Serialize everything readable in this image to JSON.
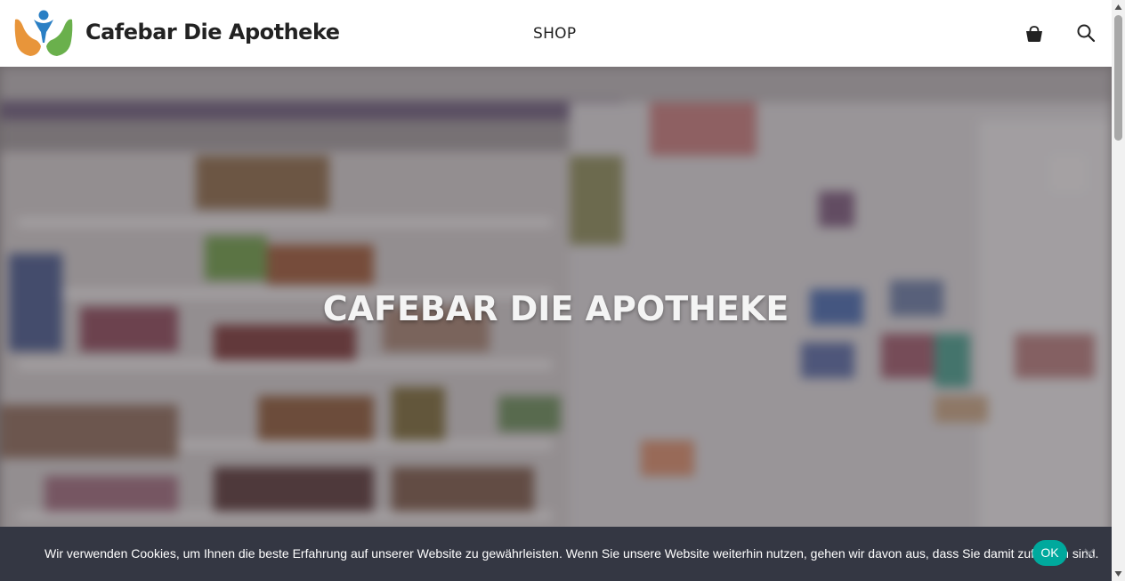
{
  "header": {
    "site_title": "Cafebar Die Apotheke",
    "nav": [
      {
        "label": "SHOP"
      }
    ],
    "icons": [
      "logo-icon",
      "cart-icon",
      "search-icon"
    ]
  },
  "hero": {
    "title": "CAFEBAR DIE APOTHEKE"
  },
  "cookie_notice": {
    "text": "Wir verwenden Cookies, um Ihnen die beste Erfahrung auf unserer Website zu gewährleisten. Wenn Sie unsere Website weiterhin nutzen, gehen wir davon aus, dass Sie damit zufrieden sind.",
    "ok_label": "OK",
    "close_icon": "close-icon"
  },
  "colors": {
    "accent": "#00a99d",
    "cookie_bar": "#343743",
    "logo_orange": "#e8953a",
    "logo_green": "#6ab04c",
    "logo_blue": "#2a7fc4"
  }
}
